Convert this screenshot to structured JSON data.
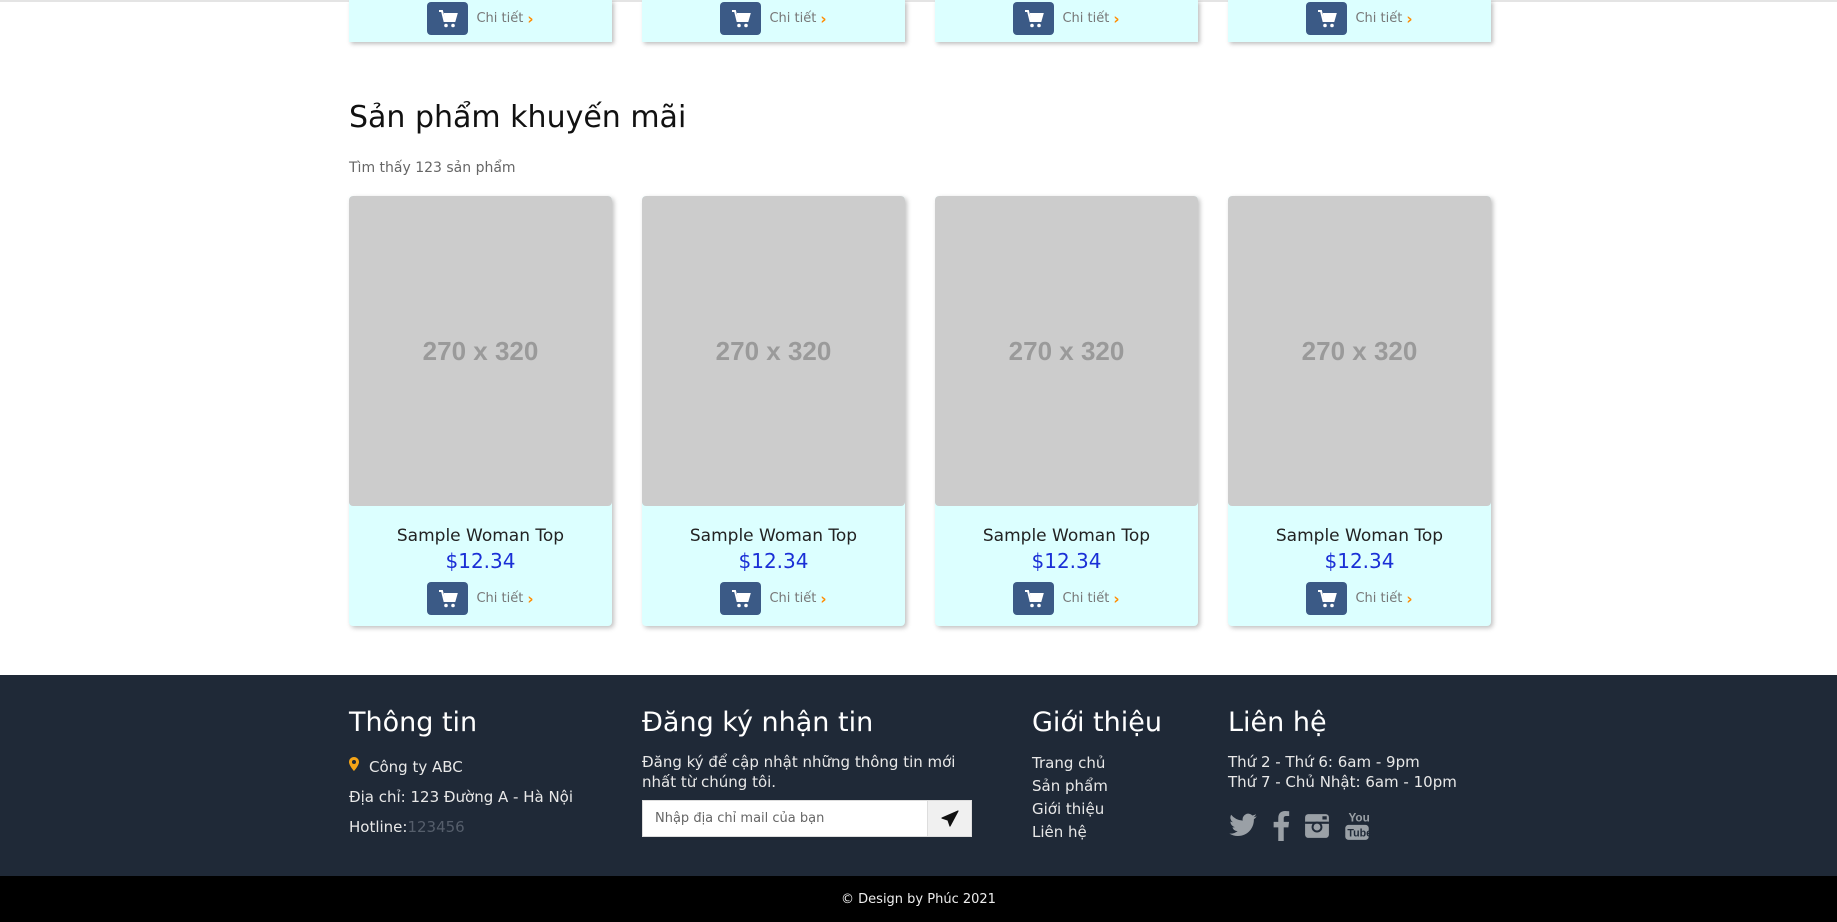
{
  "top_row": {
    "cards": [
      {
        "detail_label": "Chi tiết"
      },
      {
        "detail_label": "Chi tiết"
      },
      {
        "detail_label": "Chi tiết"
      },
      {
        "detail_label": "Chi tiết"
      }
    ]
  },
  "promo": {
    "title": "Sản phẩm khuyến mãi",
    "count_text": "Tìm thấy 123 sản phẩm",
    "products": [
      {
        "placeholder": "270 x 320",
        "name": "Sample Woman Top",
        "price": "$12.34",
        "detail_label": "Chi tiết"
      },
      {
        "placeholder": "270 x 320",
        "name": "Sample Woman Top",
        "price": "$12.34",
        "detail_label": "Chi tiết"
      },
      {
        "placeholder": "270 x 320",
        "name": "Sample Woman Top",
        "price": "$12.34",
        "detail_label": "Chi tiết"
      },
      {
        "placeholder": "270 x 320",
        "name": "Sample Woman Top",
        "price": "$12.34",
        "detail_label": "Chi tiết"
      }
    ]
  },
  "footer": {
    "info": {
      "title": "Thông tin",
      "company": "Công ty ABC",
      "address": "Địa chỉ: 123 Đường A - Hà Nội",
      "hotline_label": "Hotline:",
      "hotline_number": "123456"
    },
    "newsletter": {
      "title": "Đăng ký nhận tin",
      "description": "Đăng ký để cập nhật những thông tin mới nhất từ chúng tôi.",
      "email_placeholder": "Nhập địa chỉ mail của bạn"
    },
    "about": {
      "title": "Giới thiệu",
      "links": [
        "Trang chủ",
        "Sản phẩm",
        "Giới thiệu",
        "Liên hệ"
      ]
    },
    "contact": {
      "title": "Liên hệ",
      "weekday_hours": "Thứ 2 - Thứ 6: 6am - 9pm",
      "weekend_hours": "Thứ 7 - Chủ Nhật: 6am - 10pm",
      "social_icons": [
        "twitter-icon",
        "facebook-icon",
        "instagram-icon",
        "youtube-icon"
      ]
    },
    "copyright": "© Design by Phúc 2021"
  },
  "colors": {
    "card_bg": "#dcffff",
    "cart_button": "#3b5a86",
    "price": "#1a2fd6",
    "chevron": "#ff8c00",
    "footer_bg": "#1f2937",
    "pin": "#f4a417"
  }
}
